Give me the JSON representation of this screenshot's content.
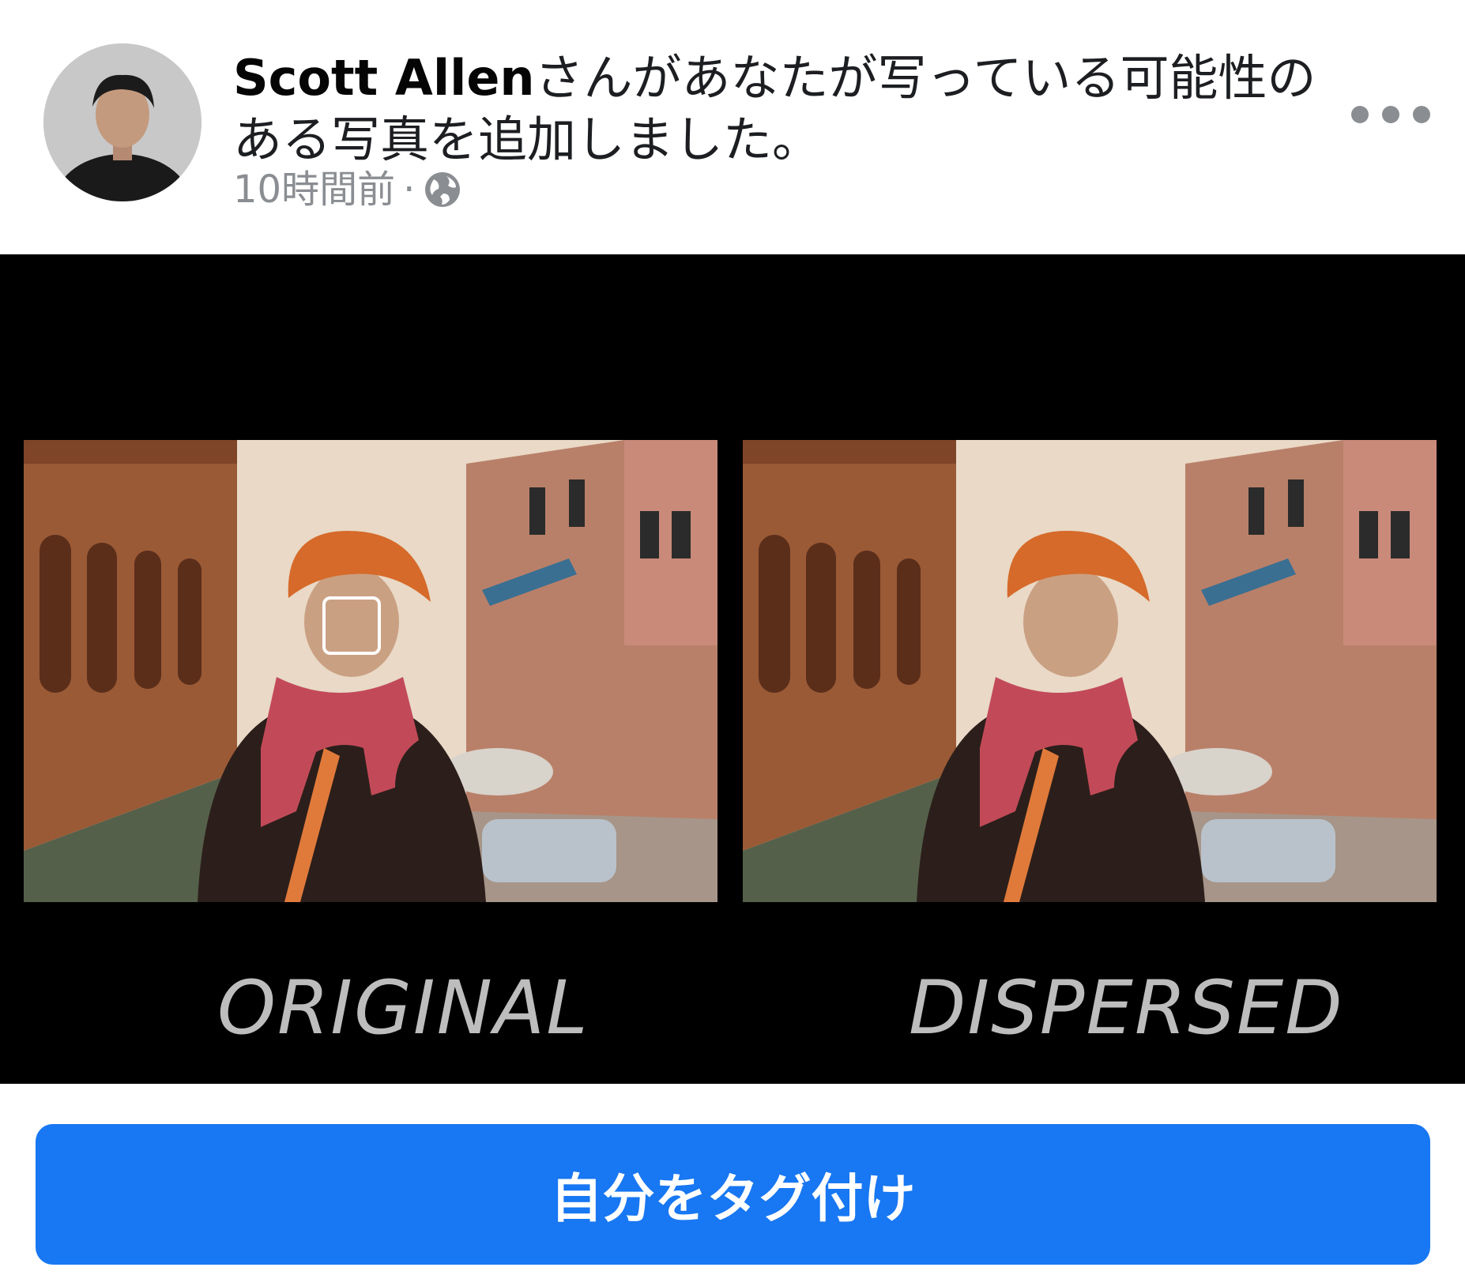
{
  "post": {
    "author": "Scott Allen",
    "message": "さんがあなたが写っている可能性のある写真を追加しました。",
    "time": "10時間前",
    "separator": "·",
    "privacy_icon": "globe-icon",
    "more_icon": "more-options-icon"
  },
  "photo": {
    "left_caption": "ORIGINAL",
    "right_caption": "DISPERSED"
  },
  "actions": {
    "tag_button_label": "自分をタグ付け"
  },
  "colors": {
    "button_bg": "#1877f2",
    "photo_bg": "#000000",
    "meta_text": "#8a8d91"
  }
}
